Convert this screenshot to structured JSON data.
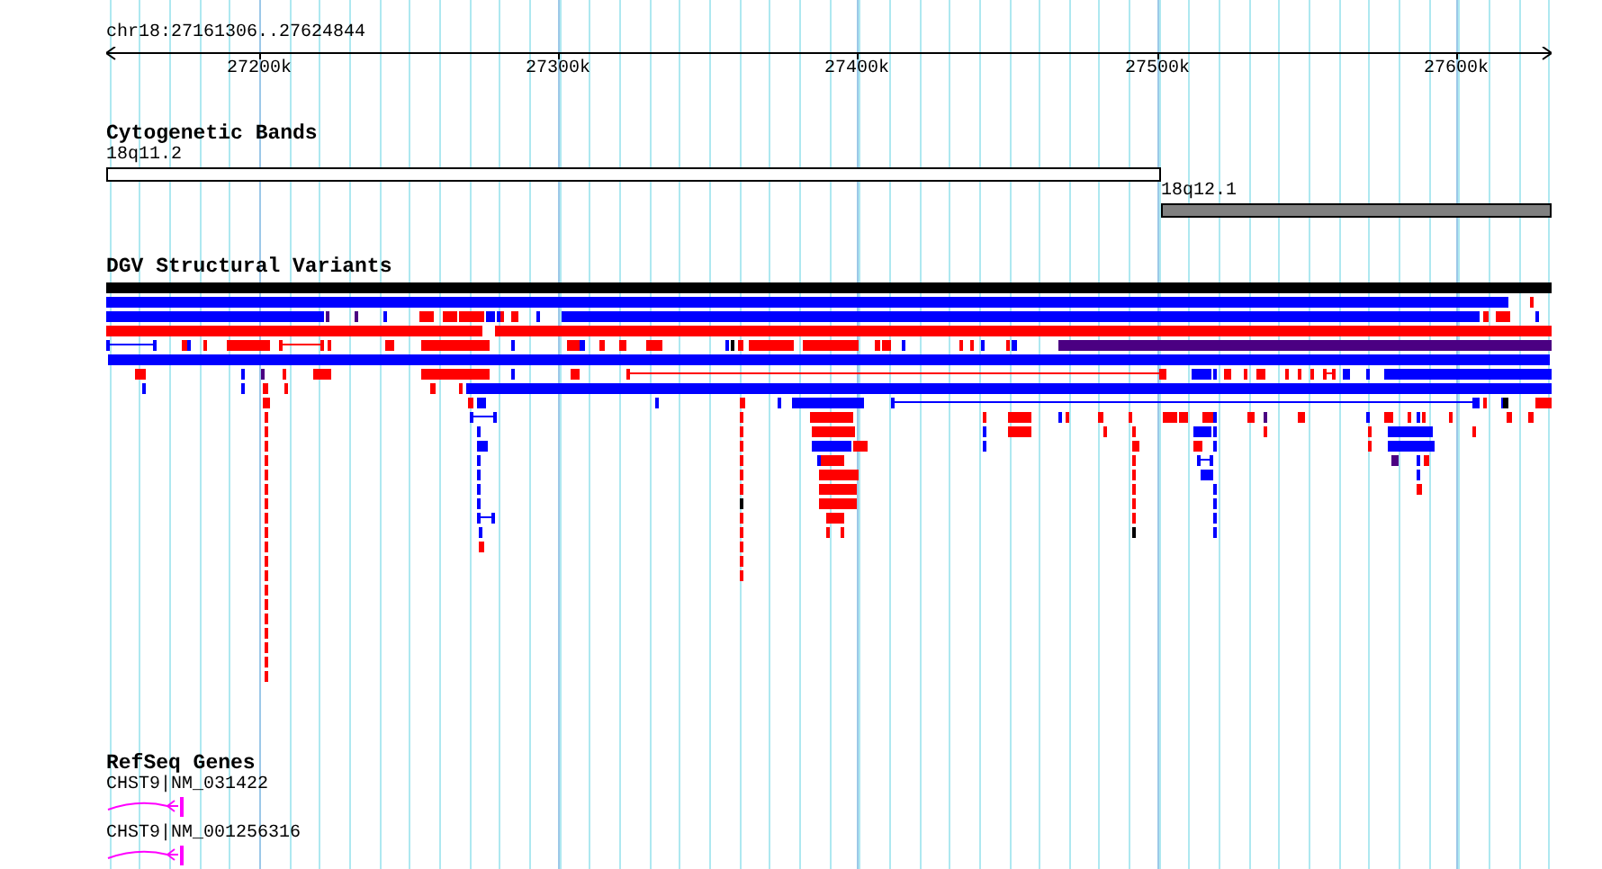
{
  "ruler": {
    "location": "chr18:27161306..27624844",
    "ticks": [
      "27200k",
      "27300k",
      "27400k",
      "27500k",
      "27600k"
    ]
  },
  "tracks": [
    {
      "kind": "bands",
      "title": "Cytogenetic Bands",
      "bands": [
        {
          "label": "18q11.2",
          "color": "#ffffff"
        },
        {
          "label": "18q12.1",
          "color": "#808080"
        }
      ]
    },
    {
      "kind": "variants",
      "title": "DGV Structural Variants"
    },
    {
      "kind": "genes",
      "title": "RefSeq Genes",
      "genes": [
        {
          "label": "CHST9|NM_031422"
        },
        {
          "label": "CHST9|NM_001256316"
        }
      ]
    }
  ]
}
